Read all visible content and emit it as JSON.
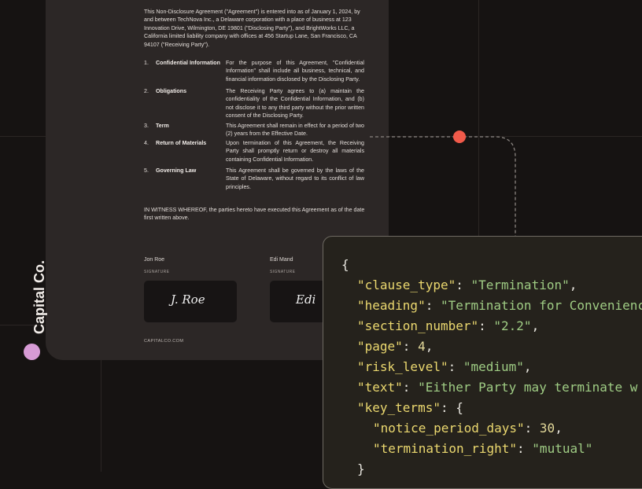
{
  "document": {
    "intro": "This Non-Disclosure Agreement (\"Agreement\") is entered into as of January 1, 2024, by and between TechNova Inc., a Delaware corporation with a place of business at 123 Innovation Drive, Wilmington, DE 19801 (\"Disclosing Party\"), and BrightWorks LLC, a California limited liability company with offices at 456 Startup Lane, San Francisco, CA 94107 (\"Receiving Party\").",
    "clauses": [
      {
        "num": "1.",
        "title": "Confidential Information",
        "body": "For the purpose of this Agreement, \"Confidential Information\" shall include all business, technical, and financial information disclosed by the Disclosing Party."
      },
      {
        "num": "2.",
        "title": "Obligations",
        "body": "The Receiving Party agrees to (a) maintain the confidentiality of the Confidential Information, and (b) not disclose it to any third party without the prior written consent of the Disclosing Party."
      },
      {
        "num": "3.",
        "title": "Term",
        "body": "This Agreement shall remain in effect for a period of two (2) years from the Effective Date."
      },
      {
        "num": "4.",
        "title": "Return of Materials",
        "body": "Upon termination of this Agreement, the Receiving Party shall promptly return or destroy all materials containing Confidential Information."
      },
      {
        "num": "5.",
        "title": "Governing Law",
        "body": "This Agreement shall be governed by the laws of the State of Delaware, without regard to its conflict of law principles."
      }
    ],
    "witness": "IN WITNESS WHEREOF, the parties hereto have executed this Agreement as of the date first written above.",
    "signers": [
      {
        "name": "Jon Roe",
        "label": "SIGNATURE",
        "signature": "J. Roe"
      },
      {
        "name": "Edi Mand",
        "label": "SIGNATURE",
        "signature": "Edi"
      }
    ],
    "brand": "Capital Co.",
    "footer_url": "CAPITALCO.COM"
  },
  "code": {
    "open_brace": "{",
    "fields": [
      {
        "key": "\"clause_type\"",
        "value": "\"Termination\"",
        "trail": ","
      },
      {
        "key": "\"heading\"",
        "value": "\"Termination for Convenience\"",
        "trail": ","
      },
      {
        "key": "\"section_number\"",
        "value": "\"2.2\"",
        "trail": ","
      },
      {
        "key": "\"page\"",
        "value": "4",
        "trail": ","
      },
      {
        "key": "\"risk_level\"",
        "value": "\"medium\"",
        "trail": ","
      },
      {
        "key": "\"text\"",
        "value": "\"Either Party may terminate w",
        "trail": ""
      },
      {
        "key": "\"key_terms\"",
        "value": "{",
        "trail": ""
      },
      {
        "key": "\"notice_period_days\"",
        "value": "30",
        "trail": ","
      },
      {
        "key": "\"termination_right\"",
        "value": "\"mutual\"",
        "trail": ""
      }
    ],
    "close_brace": "}"
  },
  "colors": {
    "accent_dot": "#f15a4a",
    "brand_dot": "#d79bd5",
    "json_key": "#ebd86f",
    "json_string": "#9fcc84"
  }
}
